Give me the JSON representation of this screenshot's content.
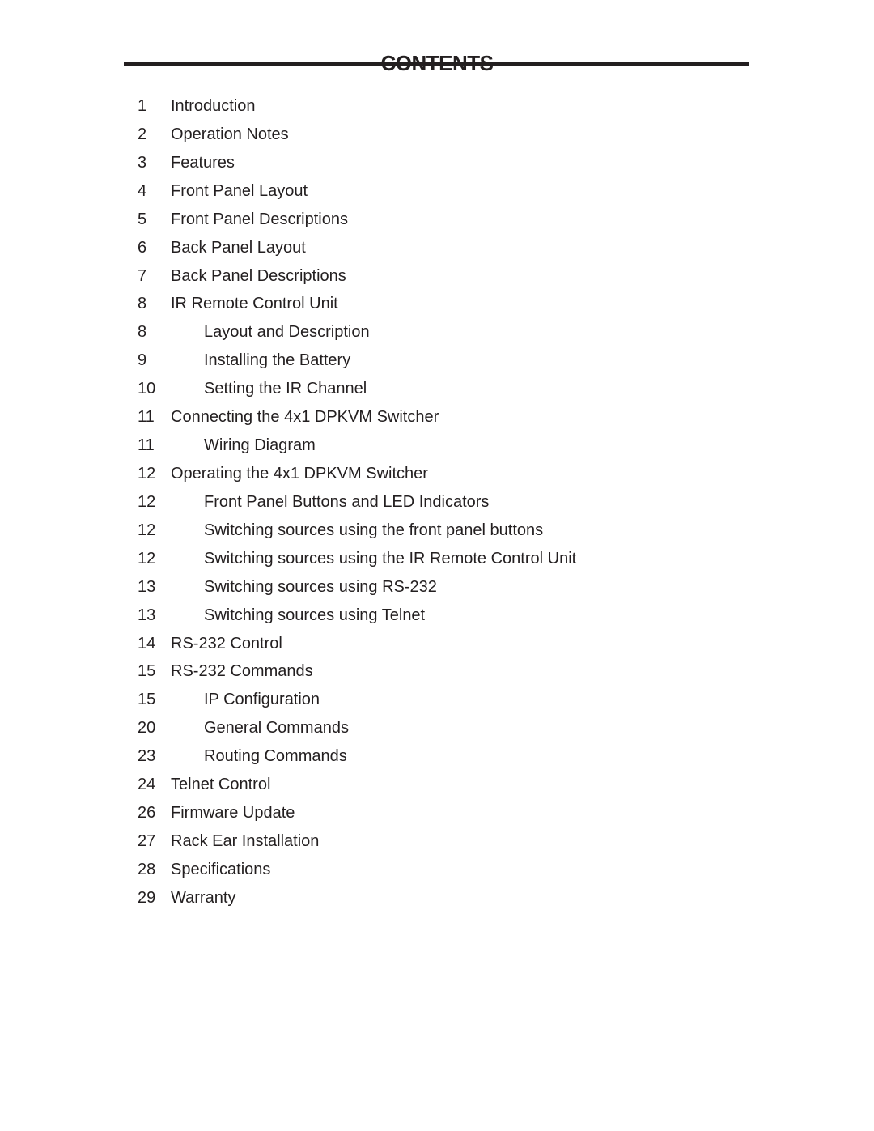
{
  "document": {
    "title": "CONTENTS",
    "entries": [
      {
        "page": "1",
        "title": "Introduction",
        "level": 1
      },
      {
        "page": "2",
        "title": "Operation Notes",
        "level": 1
      },
      {
        "page": "3",
        "title": "Features",
        "level": 1
      },
      {
        "page": "4",
        "title": "Front Panel Layout",
        "level": 1
      },
      {
        "page": "5",
        "title": "Front Panel Descriptions",
        "level": 1
      },
      {
        "page": "6",
        "title": "Back Panel Layout",
        "level": 1
      },
      {
        "page": "7",
        "title": "Back Panel Descriptions",
        "level": 1
      },
      {
        "page": "8",
        "title": "IR Remote Control Unit",
        "level": 1
      },
      {
        "page": "8",
        "title": "Layout and Description",
        "level": 2
      },
      {
        "page": "9",
        "title": "Installing the Battery",
        "level": 2
      },
      {
        "page": "10",
        "title": "Setting the IR Channel",
        "level": 2
      },
      {
        "page": "11",
        "title": "Connecting the 4x1 DPKVM Switcher",
        "level": 1
      },
      {
        "page": "11",
        "title": "Wiring Diagram",
        "level": 2
      },
      {
        "page": "12",
        "title": "Operating the 4x1 DPKVM Switcher",
        "level": 1
      },
      {
        "page": "12",
        "title": "Front Panel Buttons and LED Indicators",
        "level": 2
      },
      {
        "page": "12",
        "title": "Switching sources using the front panel buttons",
        "level": 2
      },
      {
        "page": "12",
        "title": "Switching sources using the IR Remote Control Unit",
        "level": 2
      },
      {
        "page": "13",
        "title": "Switching sources using RS-232",
        "level": 2
      },
      {
        "page": "13",
        "title": "Switching sources using Telnet",
        "level": 2
      },
      {
        "page": "14",
        "title": "RS-232 Control",
        "level": 1
      },
      {
        "page": "15",
        "title": "RS-232 Commands",
        "level": 1
      },
      {
        "page": "15",
        "title": "IP Configuration",
        "level": 2
      },
      {
        "page": "20",
        "title": "General Commands",
        "level": 2
      },
      {
        "page": "23",
        "title": "Routing Commands",
        "level": 2
      },
      {
        "page": "24",
        "title": "Telnet Control",
        "level": 1
      },
      {
        "page": "26",
        "title": "Firmware Update",
        "level": 1
      },
      {
        "page": "27",
        "title": "Rack Ear Installation",
        "level": 1
      },
      {
        "page": "28",
        "title": "Specifications",
        "level": 1
      },
      {
        "page": "29",
        "title": "Warranty",
        "level": 1
      }
    ]
  }
}
